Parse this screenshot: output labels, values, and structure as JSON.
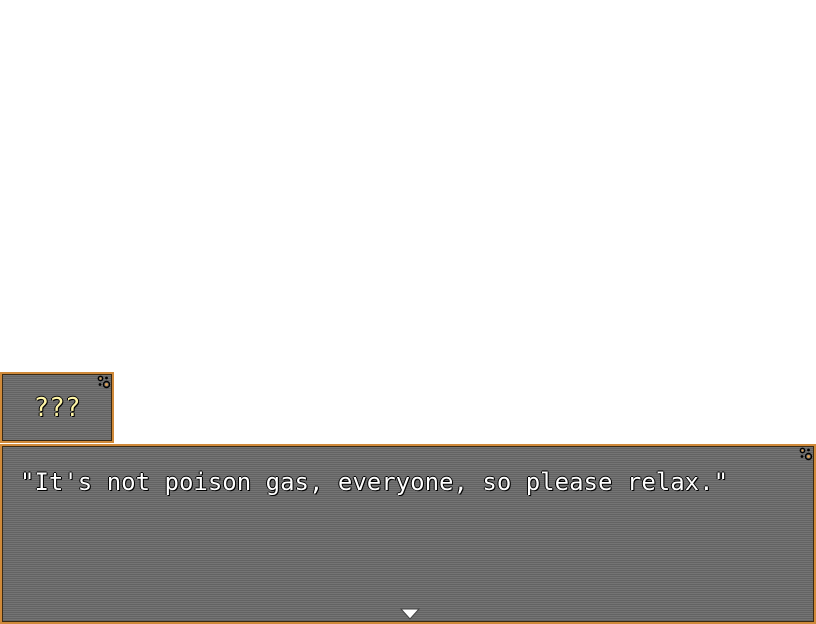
{
  "name_box": {
    "speaker": "???"
  },
  "message_box": {
    "text": "\"It's not poison gas, everyone, so please relax.\"",
    "advance_icon": "triangle-down-icon"
  },
  "colors": {
    "frame": "#d08a3a",
    "window_fill": "#6e6e6e",
    "name_text": "#fff6a8",
    "message_text": "#ffffff"
  }
}
